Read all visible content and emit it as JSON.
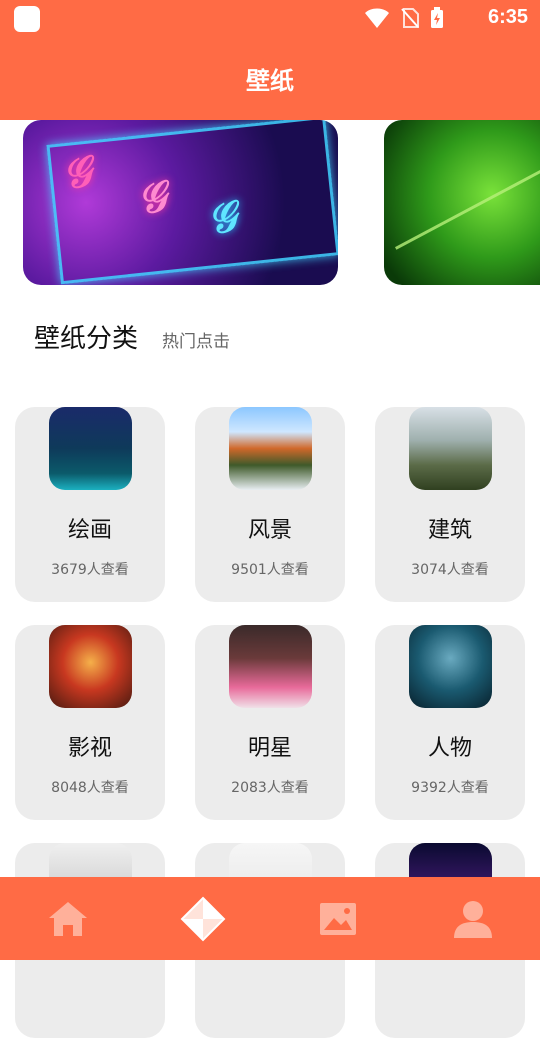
{
  "status_bar": {
    "time": "6:35",
    "icons": [
      "wifi-icon",
      "no-sim-icon",
      "battery-charging-icon"
    ]
  },
  "app_bar": {
    "title": "壁纸"
  },
  "banners": [
    {
      "name": "neon-girls-banner"
    },
    {
      "name": "green-leaf-banner"
    }
  ],
  "section": {
    "title": "壁纸分类",
    "subtitle": "热门点击"
  },
  "categories": [
    {
      "name": "绘画",
      "views": "3679人查看"
    },
    {
      "name": "风景",
      "views": "9501人查看"
    },
    {
      "name": "建筑",
      "views": "3074人查看"
    },
    {
      "name": "影视",
      "views": "8048人查看"
    },
    {
      "name": "明星",
      "views": "2083人查看"
    },
    {
      "name": "人物",
      "views": "9392人查看"
    }
  ],
  "tab_bar": {
    "tabs": [
      "home-icon",
      "pinwheel-icon",
      "image-icon",
      "person-icon"
    ],
    "active_index": 1
  },
  "colors": {
    "accent": "#ff6b45",
    "card_bg": "#ececec"
  }
}
